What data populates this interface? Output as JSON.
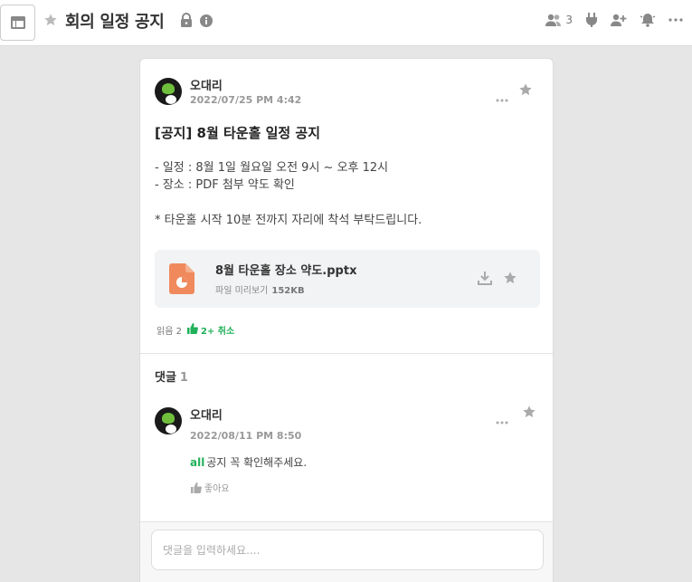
{
  "header": {
    "title": "회의 일정 공지",
    "member_count": "3"
  },
  "post": {
    "author": "오대리",
    "date": "2022/07/25 PM 4:42",
    "title": "[공지] 8월 타운홀 일정 공지",
    "lines": [
      "- 일정 : 8월 1일 월요일 오전 9시 ~ 오후 12시",
      "- 장소 : PDF 첨부 약도 확인",
      "* 타운홀 시작 10분 전까지 자리에 착석 부탁드립니다."
    ],
    "attachment": {
      "name": "8월 타운홀 장소 약도.pptx",
      "preview_label": "파일 미리보기",
      "size": "152KB"
    },
    "reads_label": "읽음 2",
    "likes_label": "2+ 취소"
  },
  "comments": {
    "header_label": "댓글",
    "count": "1",
    "items": [
      {
        "author": "오대리",
        "date": "2022/08/11 PM 8:50",
        "mention": "all",
        "text": "공지 꼭 확인해주세요.",
        "like_label": "좋아요"
      }
    ],
    "input_placeholder": "댓글을 입력하세요...."
  },
  "colors": {
    "accent_green": "#20b15a",
    "file_orange": "#f08a5d"
  },
  "icons": [
    "panel-toggle-icon",
    "star-icon",
    "lock-icon",
    "info-icon",
    "members-icon",
    "plug-icon",
    "add-member-icon",
    "bell-icon",
    "more-icon",
    "download-icon",
    "thumbs-up-icon",
    "file-pptx-icon"
  ]
}
